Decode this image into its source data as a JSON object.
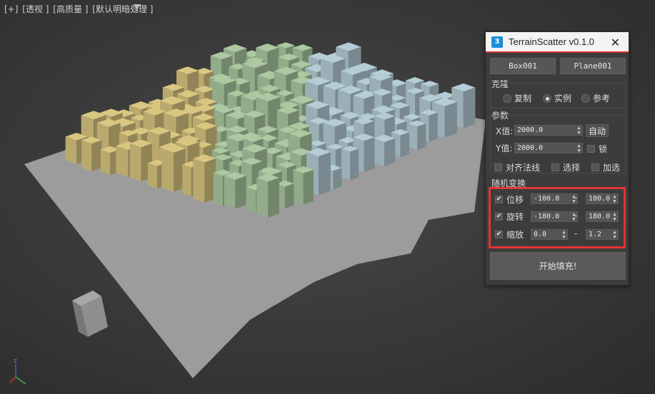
{
  "viewport": {
    "labels": [
      "[+]",
      "[透视 ]",
      "[高质量 ]",
      "[默认明暗处理 ]"
    ],
    "filter_icon": "funnel-icon",
    "axis_icon": "axis-gizmo-icon",
    "colors": {
      "yellow_boxes": "#c9b877",
      "green_boxes": "#9fba95",
      "blue_boxes": "#a8bec6",
      "ground": "#9c9c9c",
      "gray_box": "#7d7d7d"
    }
  },
  "panel": {
    "title": "TerrainScatter v0.1.0",
    "app_icon": "3ds-max-icon",
    "close_icon": "close-icon",
    "source_buttons": {
      "box": "Box001",
      "plane": "Plane001"
    },
    "clone": {
      "label": "克隆",
      "options": [
        {
          "label": "复制",
          "selected": false
        },
        {
          "label": "实例",
          "selected": true
        },
        {
          "label": "参考",
          "selected": false
        }
      ]
    },
    "params": {
      "label": "参数",
      "x_label": "X值:",
      "x_value": "2000.0",
      "auto_button": "自动",
      "y_label": "Y值:",
      "y_value": "2000.0",
      "lock_label": "锁",
      "align_normal": "对齐法线",
      "select": "选择",
      "add_select": "加选"
    },
    "random": {
      "label": "随机变换",
      "rows": [
        {
          "label": "位移",
          "checked": true,
          "min": "-100.0",
          "max": "100.0"
        },
        {
          "label": "旋转",
          "checked": true,
          "min": "-180.0",
          "max": "180.0"
        },
        {
          "label": "缩放",
          "checked": true,
          "min": "0.8",
          "max": "1.2"
        }
      ],
      "separator": "-"
    },
    "fill_button": "开始填充!",
    "accent": "#e43434"
  }
}
